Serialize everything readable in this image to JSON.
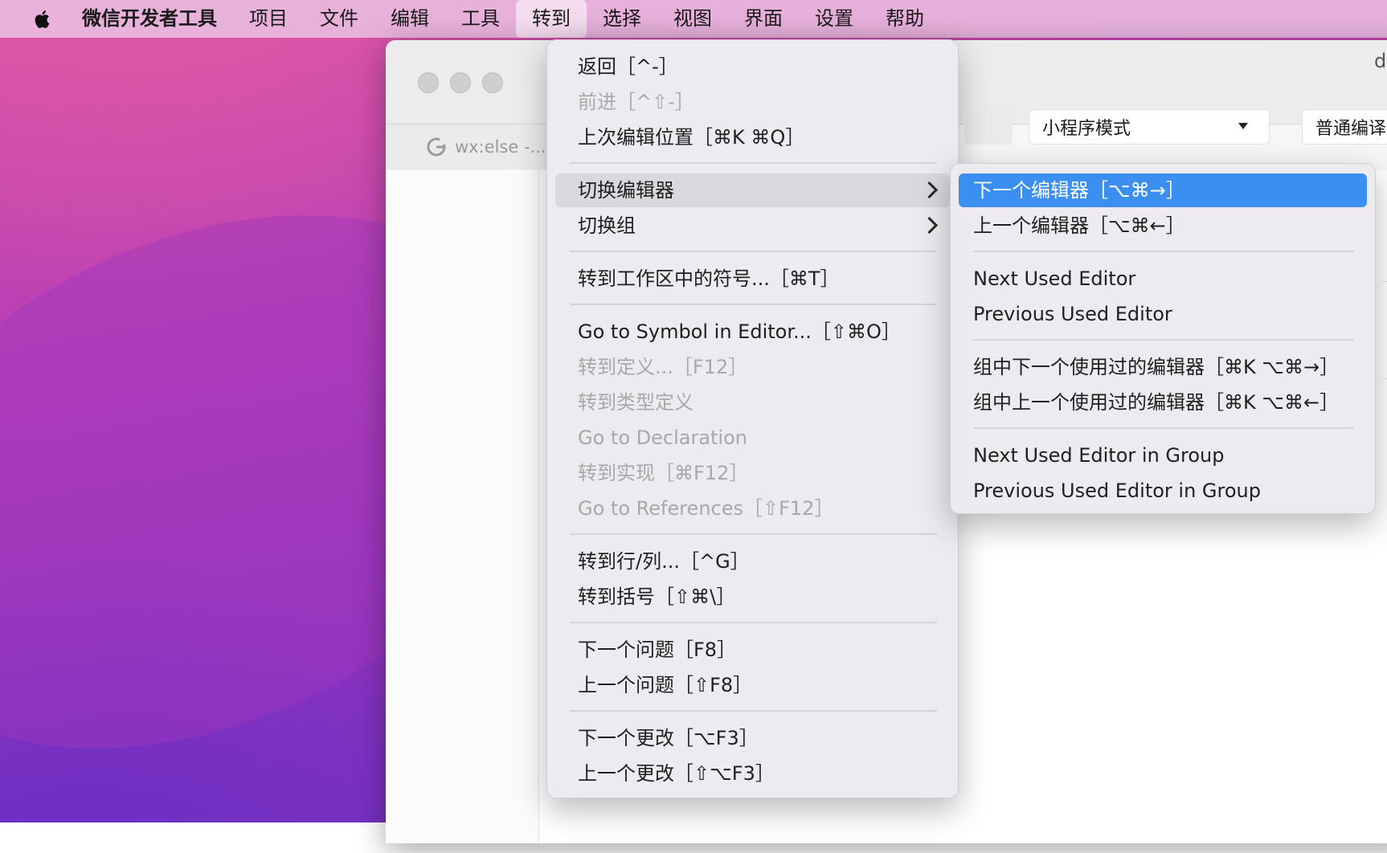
{
  "menubar": {
    "app_name": "微信开发者工具",
    "items": [
      "项目",
      "文件",
      "编辑",
      "工具",
      "转到",
      "选择",
      "视图",
      "界面",
      "设置",
      "帮助"
    ],
    "active_index": 4
  },
  "window": {
    "tab_label": "wx:else -...",
    "mode_select_value": "小程序模式",
    "compile_button_label": "普通编译",
    "title_fragment": "de"
  },
  "goto_menu": {
    "items": [
      {
        "label": "返回［^-］",
        "disabled": false
      },
      {
        "label": "前进［^⇧-］",
        "disabled": true
      },
      {
        "label": "上次编辑位置［⌘K ⌘Q］",
        "disabled": false
      },
      {
        "label": "切换编辑器",
        "disabled": false,
        "submenu": true
      },
      {
        "label": "切换组",
        "disabled": false,
        "submenu": true
      },
      {
        "label": "转到工作区中的符号...［⌘T］",
        "disabled": false
      },
      {
        "label": "Go to Symbol in Editor...［⇧⌘O］",
        "disabled": false
      },
      {
        "label": "转到定义...［F12］",
        "disabled": true
      },
      {
        "label": "转到类型定义",
        "disabled": true
      },
      {
        "label": "Go to Declaration",
        "disabled": true
      },
      {
        "label": "转到实现［⌘F12］",
        "disabled": true
      },
      {
        "label": "Go to References［⇧F12］",
        "disabled": true
      },
      {
        "label": "转到行/列...［^G］",
        "disabled": false
      },
      {
        "label": "转到括号［⇧⌘\\］",
        "disabled": false
      },
      {
        "label": "下一个问题［F8］",
        "disabled": false
      },
      {
        "label": "上一个问题［⇧F8］",
        "disabled": false
      },
      {
        "label": "下一个更改［⌥F3］",
        "disabled": false
      },
      {
        "label": "上一个更改［⇧⌥F3］",
        "disabled": false
      }
    ]
  },
  "switch_editor_submenu": {
    "items": [
      {
        "label": "下一个编辑器［⌥⌘→］",
        "selected": true
      },
      {
        "label": "上一个编辑器［⌥⌘←］"
      },
      {
        "label": "Next Used Editor"
      },
      {
        "label": "Previous Used Editor"
      },
      {
        "label": "组中下一个使用过的编辑器［⌘K ⌥⌘→］"
      },
      {
        "label": "组中上一个使用过的编辑器［⌘K ⌥⌘←］"
      },
      {
        "label": "Next Used Editor in Group"
      },
      {
        "label": "Previous Used Editor in Group"
      }
    ]
  },
  "colors": {
    "selection": "#3b8ff0",
    "menubar": "#e8badE",
    "disabled_text": "#a8a8a8"
  }
}
